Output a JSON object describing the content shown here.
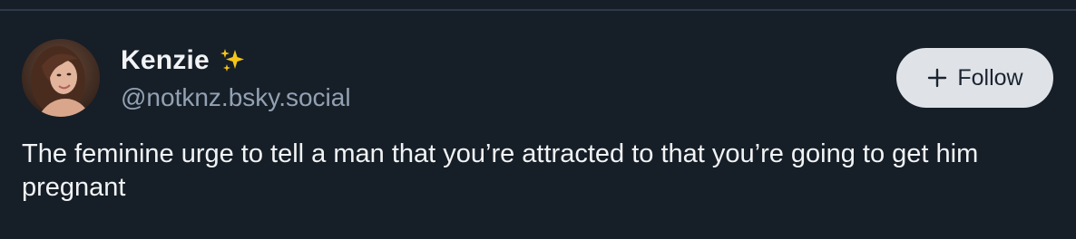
{
  "post": {
    "author": {
      "display_name": "Kenzie",
      "name_emoji_icon": "sparkles-icon",
      "handle": "@notknz.bsky.social"
    },
    "follow_button": {
      "icon": "plus-icon",
      "label": "Follow"
    },
    "text": "The feminine urge to tell a man that you’re attracted to that you’re going to get him pregnant"
  },
  "colors": {
    "background": "#161e27",
    "divider": "#2e3a48",
    "primary_text": "#f1f3f5",
    "secondary_text": "#92a1b3",
    "button_background": "#dfe3e8",
    "button_text": "#1b2430",
    "sparkle": "#f5c518"
  }
}
